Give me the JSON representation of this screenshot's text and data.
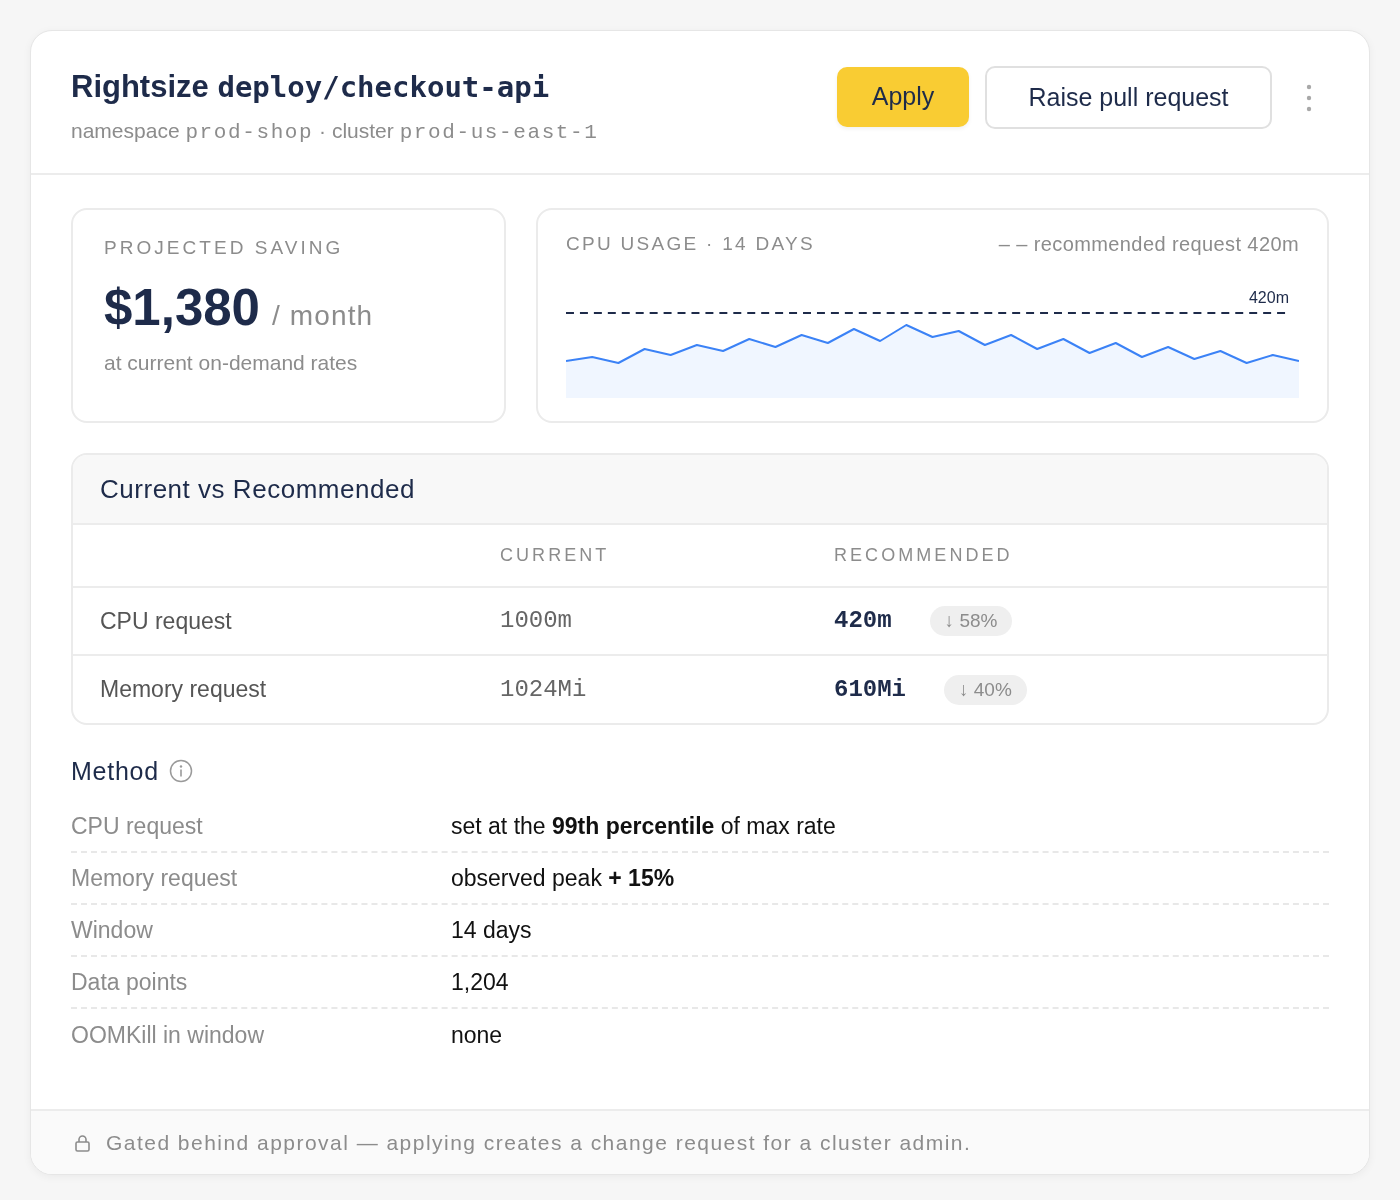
{
  "header": {
    "title": [
      {
        "kind": "text",
        "text": "Rightsize"
      },
      {
        "kind": "code",
        "text": "deploy/checkout-api"
      }
    ],
    "subtitle": [
      {
        "kind": "text",
        "text": "namespace"
      },
      {
        "kind": "code",
        "text": "prod-shop"
      },
      {
        "kind": "text",
        "text": "·"
      },
      {
        "kind": "text",
        "text": "cluster"
      },
      {
        "kind": "code",
        "text": "prod-us-east-1"
      }
    ],
    "buttons": [
      {
        "label": "Apply",
        "kind": "primary"
      },
      {
        "label": "Raise pull request",
        "kind": "outline"
      }
    ]
  },
  "saving_card": {
    "label": "PROJECTED SAVING",
    "amount": "$1,380",
    "unit": "/ month",
    "note": "at current on-demand rates"
  },
  "usage_card": {
    "title": "CPU USAGE · 14 DAYS",
    "legend": "– – recommended request 420m",
    "threshold_label": "420m"
  },
  "comparison": {
    "title": "Current vs Recommended",
    "columns": [
      "CURRENT",
      "RECOMMENDED"
    ],
    "rows": [
      {
        "label": "CPU request",
        "current": "1000m",
        "recommended": "420m",
        "change": "↓ 58%"
      },
      {
        "label": "Memory request",
        "current": "1024Mi",
        "recommended": "610Mi",
        "change": "↓ 40%"
      }
    ]
  },
  "method": {
    "title": "Method",
    "rows": [
      {
        "label": "CPU request",
        "value": "set at the **99th percentile** of max rate"
      },
      {
        "label": "Memory request",
        "value": "observed peak **+ 15%**"
      },
      {
        "label": "Window",
        "value": "14 days"
      },
      {
        "label": "Data points",
        "value": "1,204"
      },
      {
        "label": "OOMKill in window",
        "value": "none"
      }
    ]
  },
  "footer": {
    "text": "Gated behind approval — applying creates a change request for a cluster admin."
  }
}
